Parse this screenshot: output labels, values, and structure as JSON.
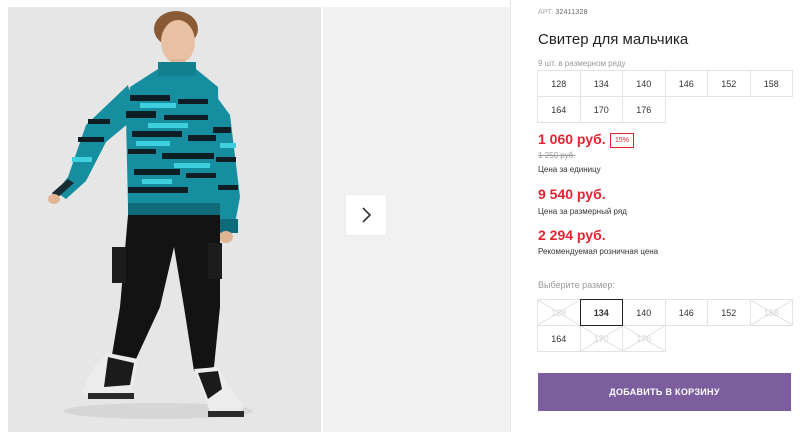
{
  "product": {
    "sku_label": "АРТ.",
    "sku_value": "32411328",
    "title": "Свитер для мальчика"
  },
  "pack": {
    "note": "9 шт. в размерном ряду",
    "sizes": [
      "128",
      "134",
      "140",
      "146",
      "152",
      "158",
      "164",
      "170",
      "176"
    ]
  },
  "prices": {
    "unit_price": "1 060 руб.",
    "discount": "15%",
    "old_price": "1 250 руб.",
    "unit_label": "Цена за единицу",
    "pack_price": "9 540 руб.",
    "pack_label": "Цена за размерный ряд",
    "retail_price": "2 294 руб.",
    "retail_label": "Рекомендуемая розничная цена"
  },
  "size_picker": {
    "label": "Выберите размер:",
    "options": [
      {
        "size": "128",
        "state": "disabled"
      },
      {
        "size": "134",
        "state": "selected"
      },
      {
        "size": "140",
        "state": "available"
      },
      {
        "size": "146",
        "state": "available"
      },
      {
        "size": "152",
        "state": "available"
      },
      {
        "size": "158",
        "state": "disabled"
      },
      {
        "size": "164",
        "state": "available"
      },
      {
        "size": "170",
        "state": "disabled"
      },
      {
        "size": "176",
        "state": "disabled"
      }
    ]
  },
  "cart": {
    "button_label": "ДОБАВИТЬ В КОРЗИНУ"
  },
  "gallery": {
    "next_icon": "chevron-right-icon"
  },
  "colors": {
    "price_red": "#e8222e",
    "button_purple": "#7c5e9e",
    "sweater_teal": "#1a8fa0"
  }
}
